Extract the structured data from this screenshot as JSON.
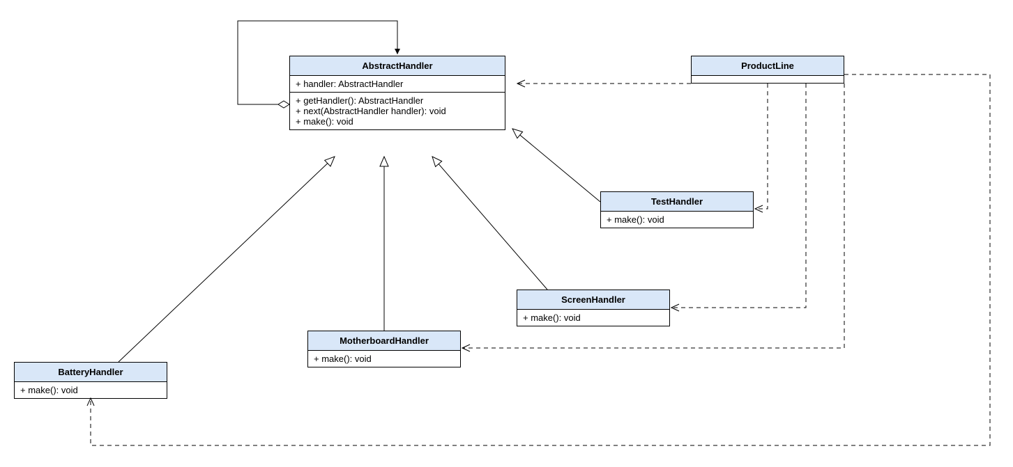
{
  "classes": {
    "abstractHandler": {
      "name": "AbstractHandler",
      "attrs": [
        "+ handler: AbstractHandler"
      ],
      "ops": [
        "+ getHandler(): AbstractHandler",
        "+ next(AbstractHandler handler): void",
        "+ make(): void"
      ]
    },
    "productLine": {
      "name": "ProductLine",
      "attrs": [],
      "ops": []
    },
    "testHandler": {
      "name": "TestHandler",
      "attrs": [],
      "ops": [
        "+ make(): void"
      ]
    },
    "screenHandler": {
      "name": "ScreenHandler",
      "attrs": [],
      "ops": [
        "+ make(): void"
      ]
    },
    "motherboardHandler": {
      "name": "MotherboardHandler",
      "attrs": [],
      "ops": [
        "+ make(): void"
      ]
    },
    "batteryHandler": {
      "name": "BatteryHandler",
      "attrs": [],
      "ops": [
        "+ make(): void"
      ]
    }
  }
}
